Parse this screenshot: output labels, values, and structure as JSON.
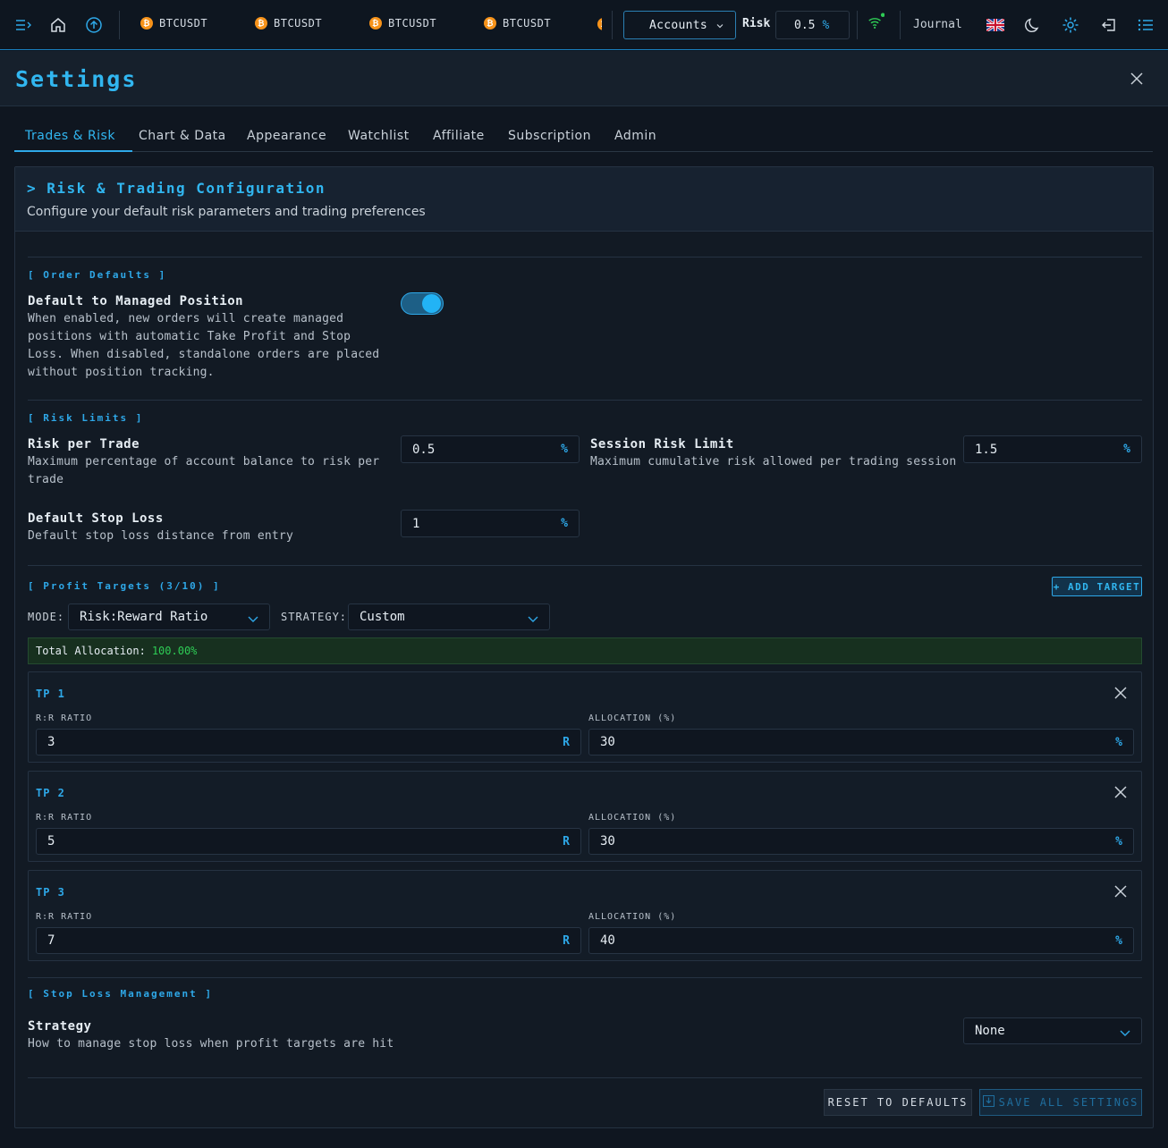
{
  "topbar": {
    "tickers": [
      "BTCUSDT",
      "BTCUSDT",
      "BTCUSDT",
      "BTCUSDT"
    ],
    "accounts_label": "Accounts",
    "risk_label": "Risk",
    "risk_value": "0.5",
    "risk_unit": "%",
    "journal_label": "Journal",
    "icons": [
      "menu-icon",
      "home-icon",
      "upload-icon",
      "bitcoin-icon",
      "wifi-icon",
      "uk-flag-icon",
      "moon-icon",
      "gear-icon",
      "logout-icon",
      "list-icon"
    ]
  },
  "settings": {
    "title": "Settings",
    "tabs": [
      "Trades & Risk",
      "Chart & Data",
      "Appearance",
      "Watchlist",
      "Affiliate",
      "Subscription",
      "Admin"
    ],
    "panel_title": "> Risk & Trading Configuration",
    "panel_subtitle": "Configure your default risk parameters and trading preferences"
  },
  "order_defaults": {
    "section": "[ Order Defaults ]",
    "managed_title": "Default to Managed Position",
    "managed_desc": "When enabled, new orders will create managed positions with automatic Take Profit and Stop Loss. When disabled, standalone orders are placed without position tracking.",
    "managed_enabled": true
  },
  "risk_limits": {
    "section": "[ Risk Limits ]",
    "risk_per_trade_title": "Risk per Trade",
    "risk_per_trade_desc": "Maximum percentage of account balance to risk per trade",
    "risk_per_trade_value": "0.5",
    "session_title": "Session Risk Limit",
    "session_desc": "Maximum cumulative risk allowed per trading session",
    "session_value": "1.5",
    "stop_title": "Default Stop Loss",
    "stop_desc": "Default stop loss distance from entry",
    "stop_value": "1",
    "pct": "%"
  },
  "profit_targets": {
    "section": "[ Profit Targets (3/10) ]",
    "add_button": "+ ADD TARGET",
    "mode_label": "MODE:",
    "mode_value": "Risk:Reward Ratio",
    "strategy_label": "STRATEGY:",
    "strategy_value": "Custom",
    "total_label": "Total Allocation:",
    "total_value": "100.00%",
    "rr_label": "R:R RATIO",
    "alloc_label": "ALLOCATION (%)",
    "r_unit": "R",
    "pct_unit": "%",
    "targets": [
      {
        "name": "TP 1",
        "rr": "3",
        "alloc": "30"
      },
      {
        "name": "TP 2",
        "rr": "5",
        "alloc": "30"
      },
      {
        "name": "TP 3",
        "rr": "7",
        "alloc": "40"
      }
    ]
  },
  "stop_loss_mgmt": {
    "section": "[ Stop Loss Management ]",
    "strategy_title": "Strategy",
    "strategy_desc": "How to manage stop loss when profit targets are hit",
    "strategy_value": "None"
  },
  "footer": {
    "reset_label": "RESET TO DEFAULTS",
    "save_label": "SAVE ALL SETTINGS"
  },
  "colors": {
    "accent": "#31b6f0",
    "background": "#0f1620",
    "success": "#2ecc55",
    "bitcoin": "#f7931a"
  }
}
